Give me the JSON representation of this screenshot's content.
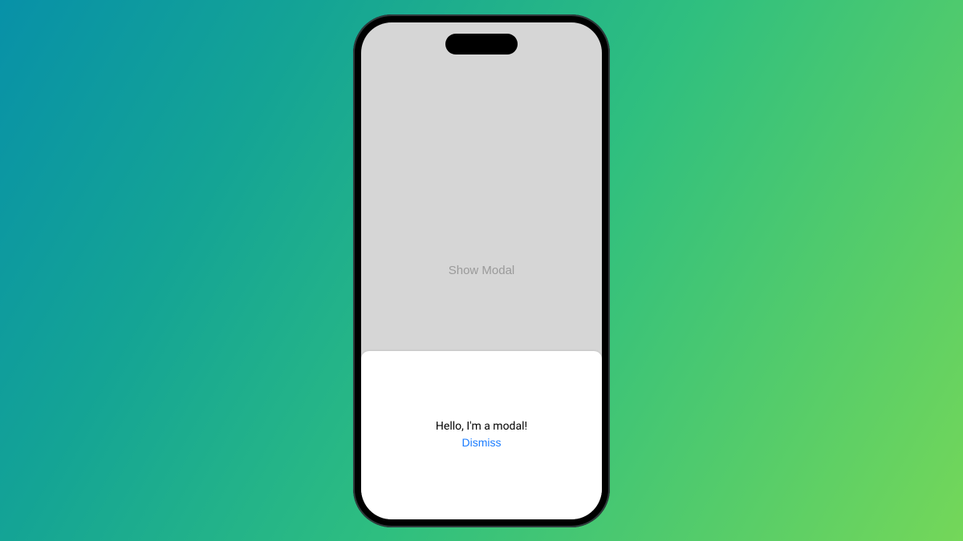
{
  "background": {
    "gradient_stops": [
      "#0891a8",
      "#14a495",
      "#2fbf7f",
      "#74d759"
    ]
  },
  "main": {
    "show_modal_label": "Show Modal"
  },
  "modal": {
    "message": "Hello, I'm a modal!",
    "dismiss_label": "Dismiss"
  }
}
